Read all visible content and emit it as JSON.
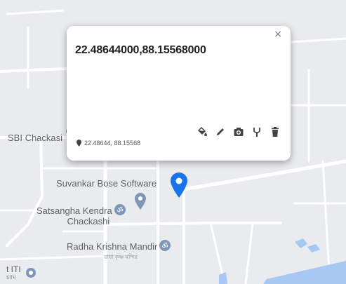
{
  "map": {
    "places": {
      "sbi": "SBI Chackasi",
      "suvankar": "Suvankar Bose Software",
      "satsangha_line1": "Satsangha Kendra",
      "satsangha_line2": "Chackashi",
      "radha": "Radha Krishna Mandir",
      "radha_sub": "রাধা কৃষ্ণ মন্দির",
      "iti_line1": "t ITI",
      "iti_line2": "চ্যাম"
    },
    "colors": {
      "road": "#ffffff",
      "land": "#e9ebee",
      "water": "#a7c8f2",
      "marker": "#1a73e8",
      "poi": "#7f97b6"
    }
  },
  "popup": {
    "title": "22.48644000,88.15568000",
    "close_glyph": "×",
    "coordinates": "22.48644, 88.15568",
    "tools": [
      "paint-bucket-icon",
      "pencil-icon",
      "camera-icon",
      "tuning-fork-icon",
      "trash-icon"
    ]
  }
}
